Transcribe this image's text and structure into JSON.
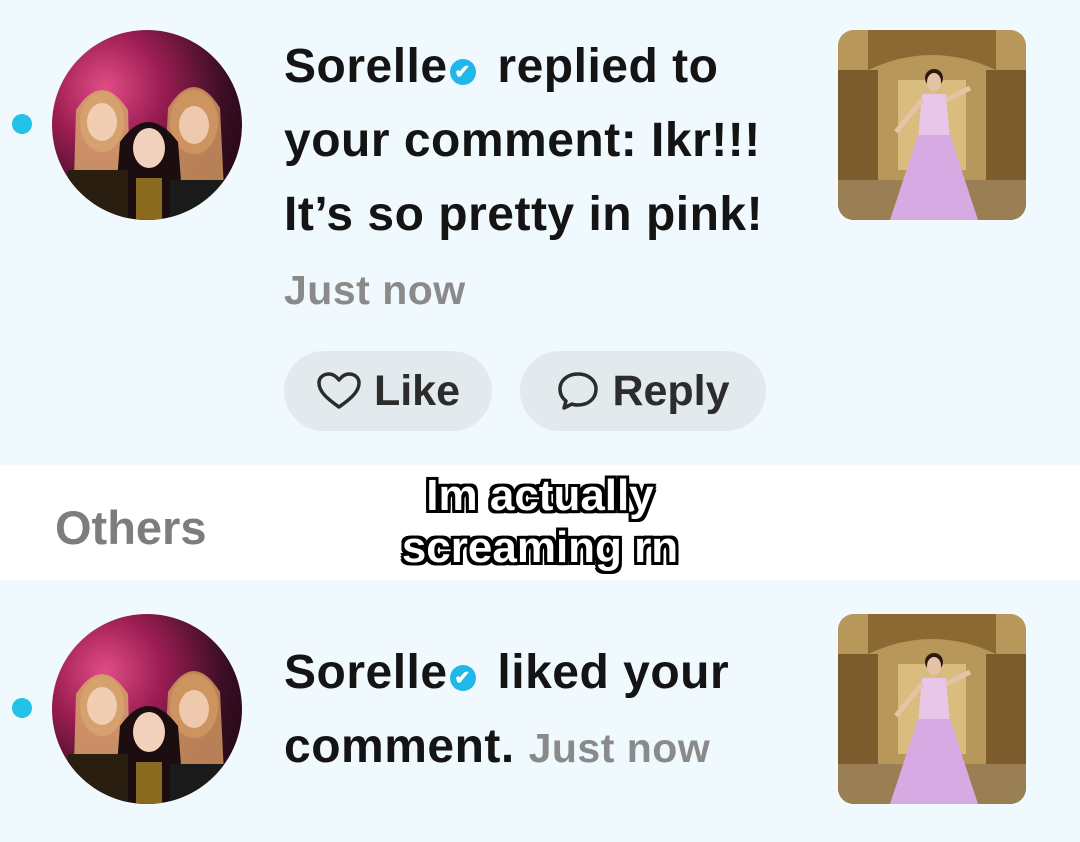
{
  "notifications": [
    {
      "username": "Sorelle",
      "action_text": " replied to your comment: Ikr!!! It’s so pretty in pink!",
      "time": "Just now",
      "actions": {
        "like_label": "Like",
        "reply_label": "Reply"
      }
    },
    {
      "username": "Sorelle",
      "action_text": " liked your comment.",
      "time": "Just now"
    }
  ],
  "section": {
    "others_label": "Others"
  },
  "caption": {
    "line1": "Im actually",
    "line2": "screaming rn"
  },
  "icons": {
    "verified": "verified-check-icon",
    "like": "heart-outline-icon",
    "reply": "speech-bubble-icon"
  },
  "colors": {
    "unread_dot": "#22c3e6",
    "verified": "#20b8ea",
    "row_bg": "#f0f9fd",
    "button_bg": "#e3eaed"
  }
}
